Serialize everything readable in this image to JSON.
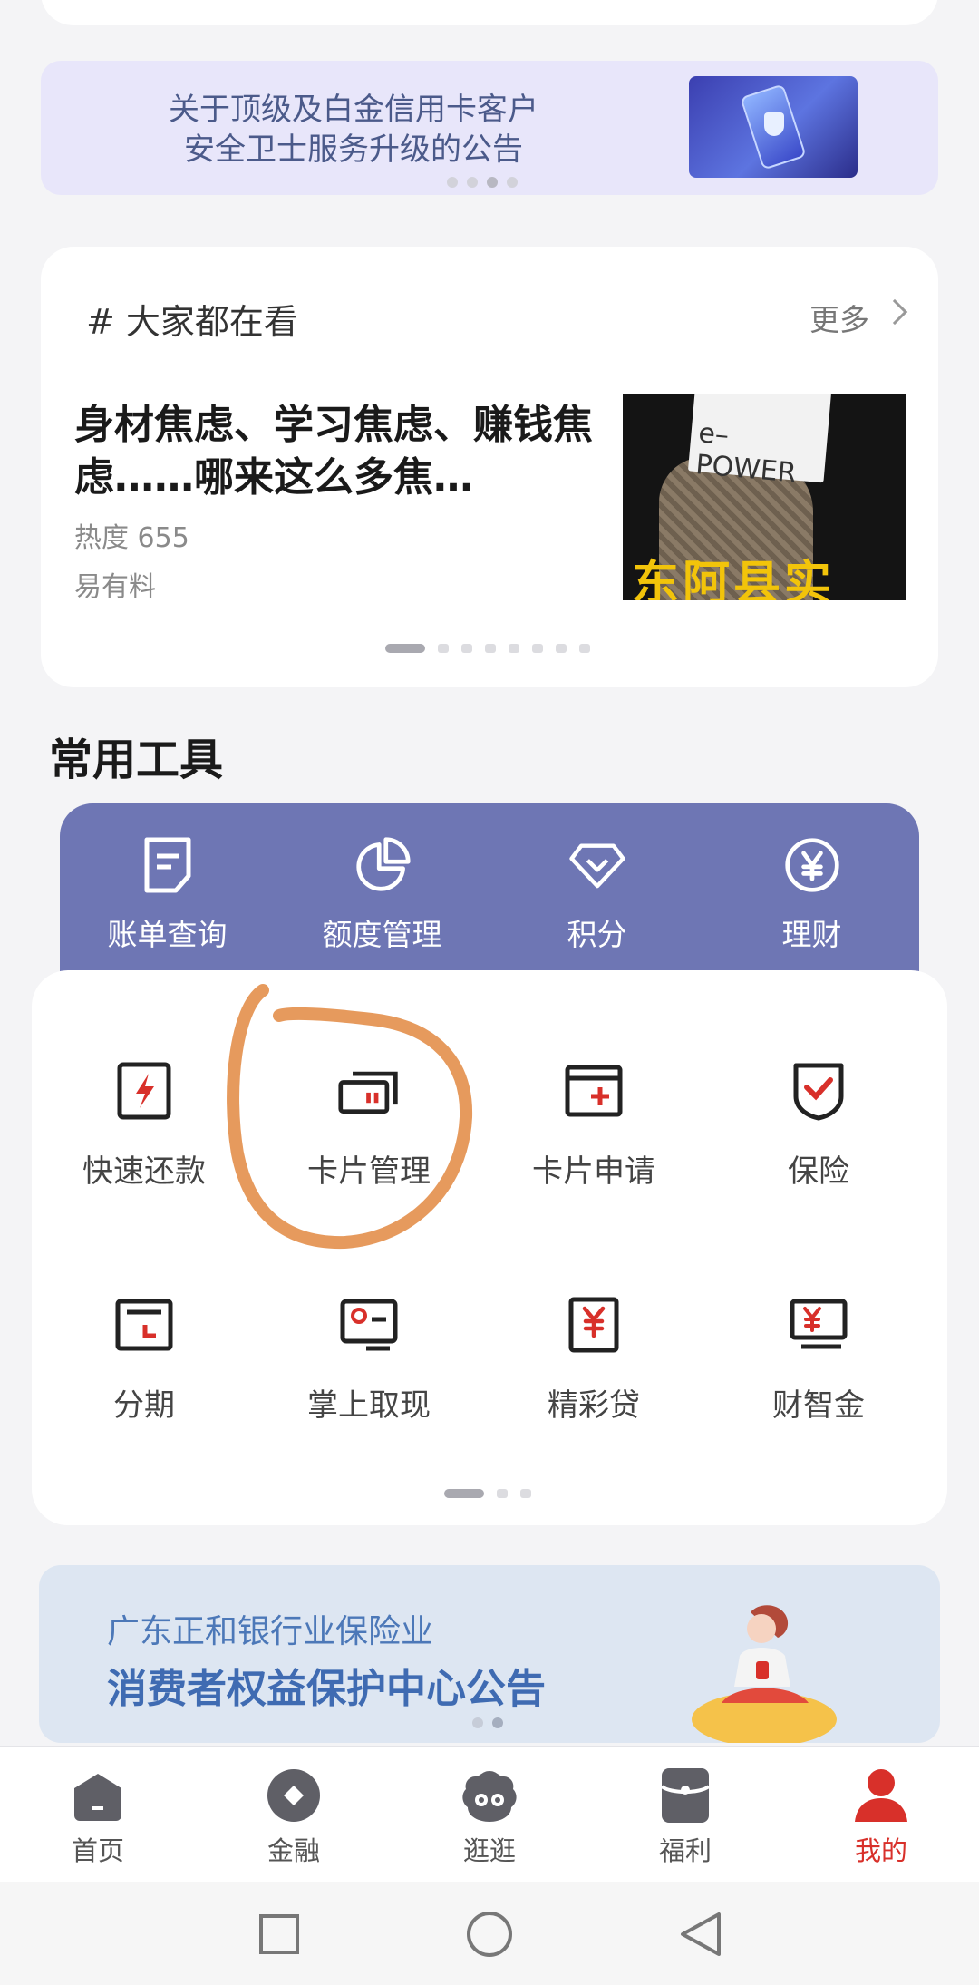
{
  "banner": {
    "line1": "关于顶级及白金信用卡客户",
    "line2": "安全卫士服务升级的公告"
  },
  "trending": {
    "title": "# 大家都在看",
    "more_label": "更多",
    "headline": "身材焦虑、学习焦虑、赚钱焦虑……哪来这么多焦…",
    "heat": "热度 655",
    "source": "易有料",
    "image_sign_text": "e–POWER",
    "image_caption": "东阿县实"
  },
  "tools": {
    "heading": "常用工具",
    "primary": [
      {
        "label": "账单查询",
        "icon": "bill-icon"
      },
      {
        "label": "额度管理",
        "icon": "pie-chart-icon"
      },
      {
        "label": "积分",
        "icon": "diamond-icon"
      },
      {
        "label": "理财",
        "icon": "yen-circle-icon"
      }
    ],
    "grid": [
      {
        "label": "快速还款",
        "icon": "lightning-card-icon"
      },
      {
        "label": "卡片管理",
        "icon": "cards-icon"
      },
      {
        "label": "卡片申请",
        "icon": "card-plus-icon"
      },
      {
        "label": "保险",
        "icon": "shield-check-icon"
      },
      {
        "label": "分期",
        "icon": "installment-icon"
      },
      {
        "label": "掌上取现",
        "icon": "cash-icon"
      },
      {
        "label": "精彩贷",
        "icon": "yen-card-icon"
      },
      {
        "label": "财智金",
        "icon": "yen-stack-icon"
      }
    ]
  },
  "notice": {
    "line1": "广东正和银行业保险业",
    "line2": "消费者权益保护中心公告"
  },
  "tabbar": {
    "items": [
      {
        "label": "首页",
        "icon": "home-icon"
      },
      {
        "label": "金融",
        "icon": "finance-icon"
      },
      {
        "label": "逛逛",
        "icon": "browse-icon"
      },
      {
        "label": "福利",
        "icon": "gift-icon"
      },
      {
        "label": "我的",
        "icon": "profile-icon"
      }
    ],
    "active": "我的"
  },
  "colors": {
    "accent": "#d8302a",
    "purple": "#6e76b4",
    "annotation": "#e4914f"
  }
}
